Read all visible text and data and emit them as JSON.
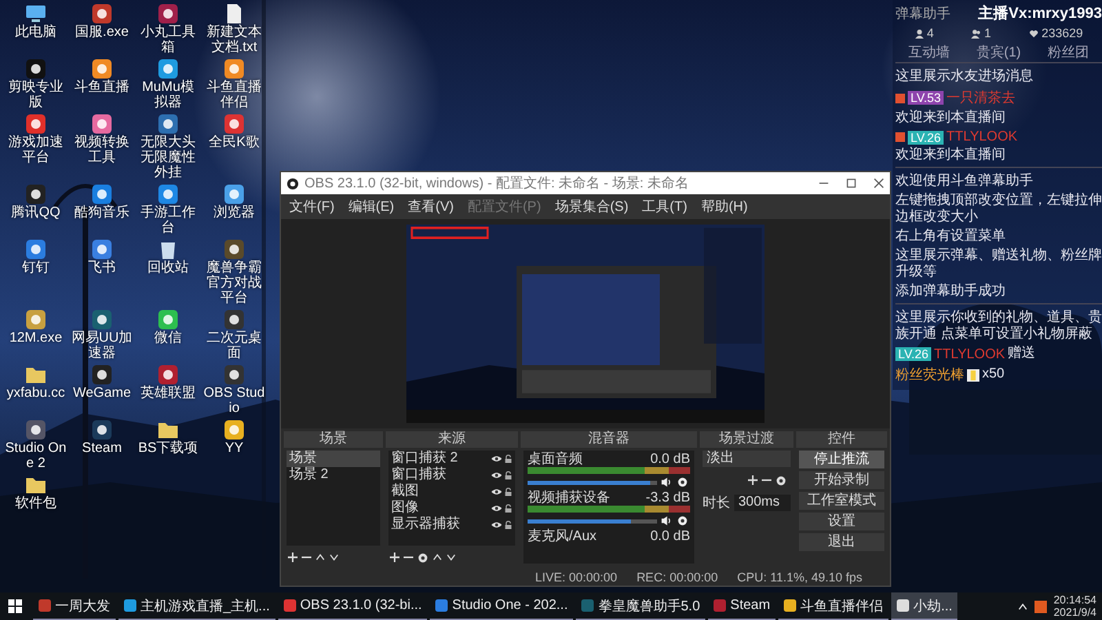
{
  "desktop_icons": [
    {
      "label": "此电脑"
    },
    {
      "label": "国服.exe"
    },
    {
      "label": "小丸工具箱"
    },
    {
      "label": "新建文本文档.txt"
    },
    {
      "label": "剪映专业版"
    },
    {
      "label": "斗鱼直播"
    },
    {
      "label": "MuMu模拟器"
    },
    {
      "label": "斗鱼直播伴侣"
    },
    {
      "label": "游戏加速平台"
    },
    {
      "label": "视频转换工具"
    },
    {
      "label": "无限大头无限魔性外挂"
    },
    {
      "label": "全民K歌"
    },
    {
      "label": "腾讯QQ"
    },
    {
      "label": "酷狗音乐"
    },
    {
      "label": "手游工作台"
    },
    {
      "label": "浏览器"
    },
    {
      "label": "钉钉"
    },
    {
      "label": "飞书"
    },
    {
      "label": "回收站"
    },
    {
      "label": "魔兽争霸官方对战平台"
    },
    {
      "label": "12M.exe"
    },
    {
      "label": "网易UU加速器"
    },
    {
      "label": "微信"
    },
    {
      "label": "二次元桌面"
    },
    {
      "label": "yxfabu.cc"
    },
    {
      "label": "WeGame"
    },
    {
      "label": "英雄联盟"
    },
    {
      "label": "OBS Studio"
    },
    {
      "label": "Studio One 2"
    },
    {
      "label": "Steam"
    },
    {
      "label": "BS下载项"
    },
    {
      "label": "YY"
    },
    {
      "label": "软件包"
    }
  ],
  "obs": {
    "title": "OBS 23.1.0 (32-bit, windows) - 配置文件: 未命名 - 场景: 未命名",
    "menu": [
      {
        "label": "文件(F)",
        "disabled": false
      },
      {
        "label": "编辑(E)",
        "disabled": false
      },
      {
        "label": "查看(V)",
        "disabled": false
      },
      {
        "label": "配置文件(P)",
        "disabled": true
      },
      {
        "label": "场景集合(S)",
        "disabled": false
      },
      {
        "label": "工具(T)",
        "disabled": false
      },
      {
        "label": "帮助(H)",
        "disabled": false
      }
    ],
    "scenes": {
      "title": "场景",
      "items": [
        {
          "label": "场景",
          "selected": true
        },
        {
          "label": "场景 2",
          "selected": false
        }
      ]
    },
    "sources": {
      "title": "来源",
      "items": [
        {
          "label": "窗口捕获 2"
        },
        {
          "label": "窗口捕获"
        },
        {
          "label": "截图"
        },
        {
          "label": "图像"
        },
        {
          "label": "显示器捕获"
        }
      ]
    },
    "mixer": {
      "title": "混音器",
      "channels": [
        {
          "name": "桌面音频",
          "reading": "0.0 dB",
          "level": 0.95
        },
        {
          "name": "视频捕获设备",
          "reading": "-3.3 dB",
          "level": 0.8
        },
        {
          "name": "麦克风/Aux",
          "reading": "0.0 dB"
        }
      ]
    },
    "transitions": {
      "title": "场景过渡",
      "type": "淡出",
      "duration_label": "时长",
      "duration": "300ms"
    },
    "controls": {
      "title": "控件",
      "buttons": [
        {
          "label": "停止推流",
          "selected": true
        },
        {
          "label": "开始录制",
          "selected": false
        },
        {
          "label": "工作室模式",
          "selected": false
        },
        {
          "label": "设置",
          "selected": false
        },
        {
          "label": "退出",
          "selected": false
        }
      ]
    },
    "status": [
      "LIVE: 00:00:00",
      "REC: 00:00:00",
      "CPU: 11.1%, 49.10 fps"
    ]
  },
  "overlay": {
    "header": "弹幕助手",
    "streamer": "主播Vx:mrxy1993",
    "stats": [
      {
        "value": "4"
      },
      {
        "value": "1"
      },
      {
        "value": "233629"
      }
    ],
    "tabs": [
      {
        "label": "互动墙",
        "selected": false
      },
      {
        "label": "贵宾(1)",
        "selected": false
      },
      {
        "label": "粉丝团",
        "selected": false
      }
    ],
    "entry_notice": "这里展示水友进场消息",
    "entries": [
      {
        "badge": "LV.53",
        "color": "#8e44ad",
        "name": "一只清茶去",
        "message": "欢迎来到本直播间"
      },
      {
        "badge": "LV.26",
        "color": "#2bb3b3",
        "name": "TTLYLOOK",
        "message": "欢迎来到本直播间"
      }
    ],
    "help": [
      "欢迎使用斗鱼弹幕助手",
      "左键拖拽顶部改变位置，左键拉伸边框改变大小",
      "右上角有设置菜单",
      "这里展示弹幕、赠送礼物、粉丝牌升级等",
      "添加弹幕助手成功"
    ],
    "gift_notice": "这里展示你收到的礼物、道具、贵族开通 点菜单可设置小礼物屏蔽",
    "gifts": [
      {
        "badge": "LV.26",
        "color": "#2bb3b3",
        "name": "TTLYLOOK",
        "verb": "赠送",
        "gift": "粉丝荧光棒",
        "count": "x50"
      }
    ]
  },
  "taskbar": {
    "items": [
      {
        "label": "一周大发",
        "selected": false
      },
      {
        "label": "主机游戏直播_主机...",
        "selected": false
      },
      {
        "label": "OBS 23.1.0 (32-bi...",
        "selected": false
      },
      {
        "label": "Studio One - 202...",
        "selected": false
      },
      {
        "label": "拳皇魔兽助手5.0",
        "selected": false
      },
      {
        "label": "Steam",
        "selected": false
      },
      {
        "label": "斗鱼直播伴侣",
        "selected": false
      },
      {
        "label": "小劫...",
        "selected": true
      }
    ],
    "time": "20:14:54",
    "date": "2021/9/4"
  }
}
